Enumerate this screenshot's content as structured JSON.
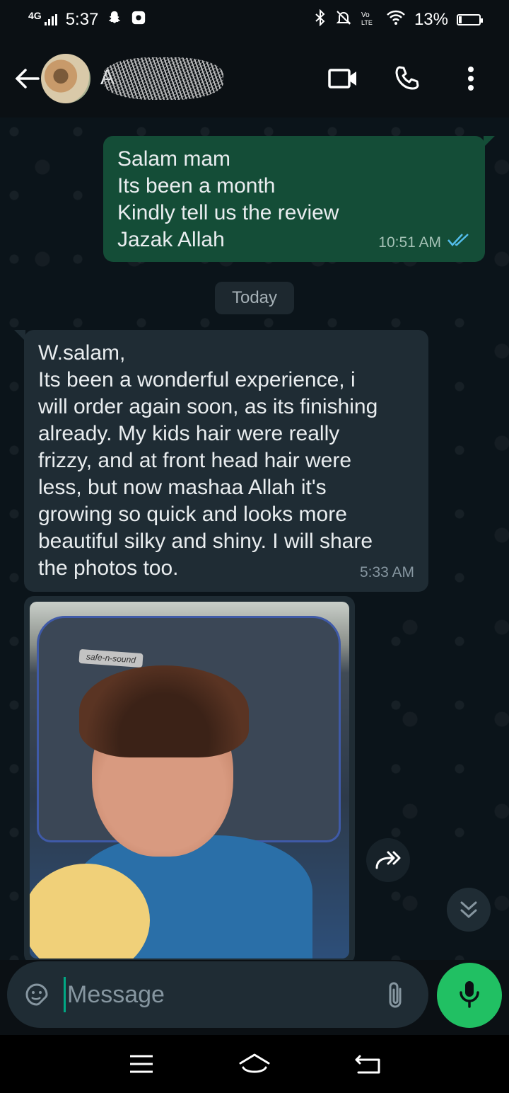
{
  "status_bar": {
    "network": "4G",
    "time": "5:37",
    "battery": "13%",
    "battery_level": 0.13,
    "icons": [
      "snapchat-icon",
      "notification-icon",
      "bluetooth-icon",
      "mute-icon",
      "volte-icon",
      "wifi-icon",
      "battery-icon"
    ]
  },
  "header": {
    "contact_initial": "A",
    "icons": [
      "back-arrow-icon",
      "video-call-icon",
      "voice-call-icon",
      "more-options-icon"
    ]
  },
  "messages": {
    "outgoing": {
      "lines": [
        "Salam mam",
        "Its been a month",
        "Kindly tell us the review",
        "Jazak Allah"
      ],
      "time": "10:51 AM"
    },
    "date_divider": "Today",
    "incoming": {
      "lines": [
        "W.salam,",
        "Its been a wonderful experience, i",
        "will order again soon, as its finishing",
        "already. My kids hair were really",
        "frizzy, and at front head hair were",
        "less, but now mashaa Allah it's",
        "growing so quick and looks more",
        "beautiful silky and shiny. I will share",
        "the photos too."
      ],
      "time": "5:33 AM"
    },
    "photo_seat_brand": "safe-n-sound"
  },
  "composer": {
    "placeholder": "Message",
    "value": ""
  },
  "colors": {
    "outgoing_bubble": "#144d37",
    "incoming_bubble": "#1f2c34",
    "accent_green": "#21c063",
    "read_tick": "#53bdeb"
  }
}
